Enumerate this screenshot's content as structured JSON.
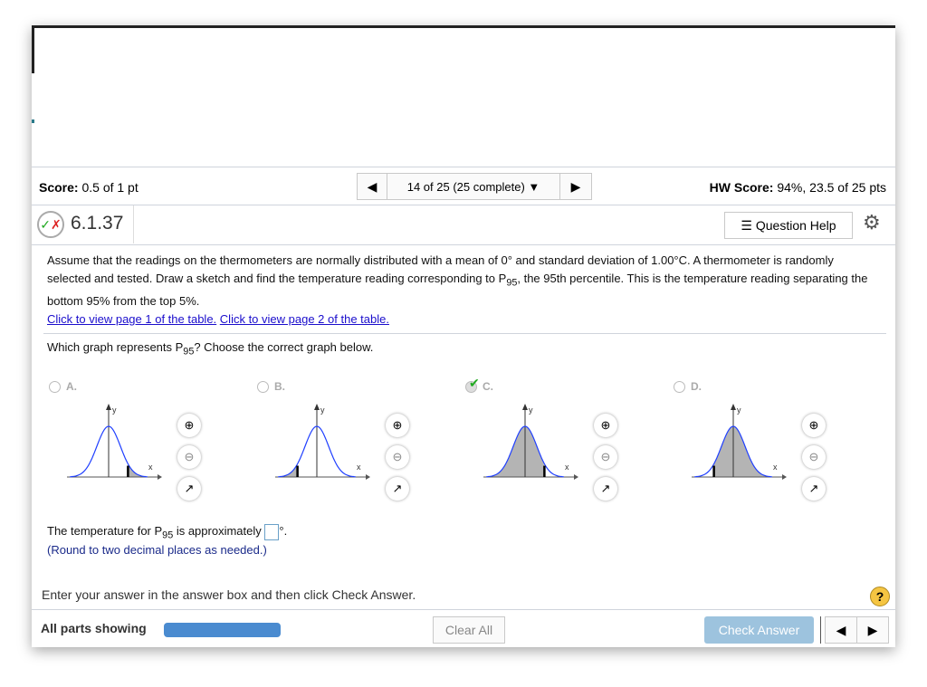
{
  "header": {
    "score_label": "Score:",
    "score_value": "0.5 of 1 pt",
    "progress": "14 of 25 (25 complete)",
    "hw_label": "HW Score:",
    "hw_value": "94%, 23.5 of 25 pts"
  },
  "question": {
    "number": "6.1.37",
    "help_label": "Question Help",
    "text_1": "Assume that the readings on the thermometers are normally distributed with a mean of 0° and standard deviation of 1.00°C. A thermometer is randomly selected and tested. Draw a sketch and find the temperature reading corresponding to P",
    "sub": "95",
    "text_2": ", the 95th percentile. This is the temperature reading separating the bottom 95% from the top 5%.",
    "link1": "Click to view page 1 of the table.",
    "link2": "Click to view page 2 of the table.",
    "prompt_1": "Which graph represents P",
    "prompt_2": "? Choose the correct graph below.",
    "options": [
      {
        "label": "A.",
        "shade": "right-tail"
      },
      {
        "label": "B.",
        "shade": "left-tail"
      },
      {
        "label": "C.",
        "shade": "left-of-right-cut",
        "selected": true
      },
      {
        "label": "D.",
        "shade": "right-of-left-cut"
      }
    ],
    "axis_x": "x",
    "axis_y": "y",
    "answer_1": "The temperature for P",
    "answer_2": " is approximately",
    "degree": "°.",
    "round_note": "(Round to two decimal places as needed.)"
  },
  "footer": {
    "instruction": "Enter your answer in the answer box and then click Check Answer.",
    "parts": "All parts showing",
    "clear": "Clear All",
    "check": "Check Answer"
  },
  "colors": {
    "curve": "#1f3fff",
    "check_btn": "#9dc3de",
    "progress_bar": "#4a8bd0"
  }
}
